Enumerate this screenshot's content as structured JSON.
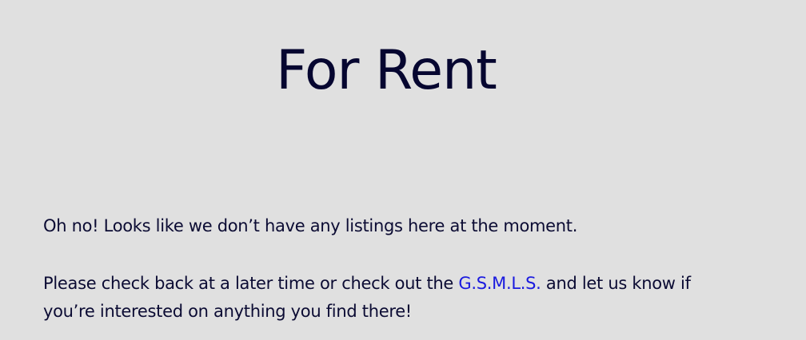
{
  "page": {
    "title": "For Rent"
  },
  "message": {
    "empty_notice": "Oh no! Looks like we don’t have any listings here at the moment.",
    "followup_before_link": "Please check back at a later time or check out the ",
    "link_text": "G.S.M.L.S.",
    "followup_after_link": " and let us know if you’re interested on anything you find there!"
  },
  "colors": {
    "background": "#e0e0e0",
    "text": "#0b0b33",
    "link": "#1a1adf"
  }
}
